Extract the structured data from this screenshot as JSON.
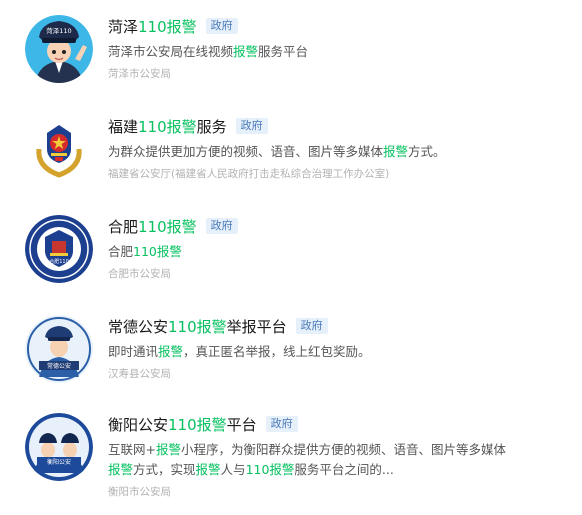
{
  "accounts": [
    {
      "title_pre": "菏泽",
      "title_hl": "110报警",
      "title_post": "",
      "badge": "政府",
      "desc": [
        {
          "t": "菏泽市公安局在线视频",
          "hl": false
        },
        {
          "t": "报警",
          "hl": true
        },
        {
          "t": "服务平台",
          "hl": false
        }
      ],
      "source": "菏泽市公安局",
      "logo_icon": "police-officer-cartoon-icon",
      "logo_text": "菏泽110"
    },
    {
      "title_pre": "福建",
      "title_hl": "110报警",
      "title_post": "服务",
      "badge": "政府",
      "desc": [
        {
          "t": "为群众提供更加方便的视频、语音、图片等多媒体",
          "hl": false
        },
        {
          "t": "报警",
          "hl": true
        },
        {
          "t": "方式。",
          "hl": false
        }
      ],
      "source": "福建省公安厅(福建省人民政府打击走私综合治理工作办公室)",
      "logo_icon": "police-emblem-icon",
      "logo_text": ""
    },
    {
      "title_pre": "合肥",
      "title_hl": "110报警",
      "title_post": "",
      "badge": "政府",
      "desc": [
        {
          "t": "合肥",
          "hl": false
        },
        {
          "t": "110报警",
          "hl": true
        }
      ],
      "source": "合肥市公安局",
      "logo_icon": "police-badge-icon",
      "logo_text": "合肥110"
    },
    {
      "title_pre": "常德公安",
      "title_hl": "110报警",
      "title_post": "举报平台",
      "badge": "政府",
      "desc": [
        {
          "t": "即时通讯",
          "hl": false
        },
        {
          "t": "报警",
          "hl": true
        },
        {
          "t": "，真正匿名举报，线上红包奖励。",
          "hl": false
        }
      ],
      "source": "汉寿县公安局",
      "logo_icon": "police-officer-icon",
      "logo_text": "常德公安"
    },
    {
      "title_pre": "衡阳公安",
      "title_hl": "110报警",
      "title_post": "平台",
      "badge": "政府",
      "desc": [
        {
          "t": "互联网+",
          "hl": false
        },
        {
          "t": "报警",
          "hl": true
        },
        {
          "t": "小程序，为衡阳群众提供方便的视频、语音、图片等多媒体",
          "hl": false
        },
        {
          "t": "报警",
          "hl": true
        },
        {
          "t": "方式，实现",
          "hl": false
        },
        {
          "t": "报警",
          "hl": true
        },
        {
          "t": "人与",
          "hl": false
        },
        {
          "t": "110报警",
          "hl": true
        },
        {
          "t": "服务平台之间的...",
          "hl": false
        }
      ],
      "source": "衡阳市公安局",
      "logo_icon": "police-officers-pair-icon",
      "logo_text": "衡阳公安"
    }
  ]
}
